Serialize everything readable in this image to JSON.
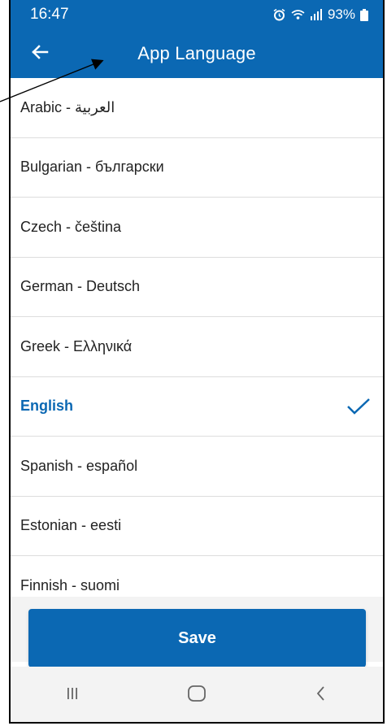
{
  "status_bar": {
    "time": "16:47",
    "battery": "93%",
    "alarm_icon": "alarm-clock-icon",
    "wifi_icon": "wifi-icon",
    "signal_icon": "signal-bars-icon",
    "battery_icon": "battery-icon"
  },
  "app_bar": {
    "title": "App Language",
    "back_icon": "arrow-left-icon"
  },
  "languages": [
    {
      "label": "Arabic - العربية"
    },
    {
      "label": "Bulgarian - български"
    },
    {
      "label": "Czech - čeština"
    },
    {
      "label": "German - Deutsch"
    },
    {
      "label": "Greek - Ελληνικά"
    },
    {
      "label": "English"
    },
    {
      "label": "Spanish - español"
    },
    {
      "label": "Estonian - eesti"
    },
    {
      "label": "Finnish - suomi"
    }
  ],
  "selected_language": "English",
  "save_button": {
    "label": "Save"
  },
  "nav_bar": {
    "recent_icon": "recent-apps-icon",
    "home_icon": "home-icon",
    "back_icon": "chevron-left-icon"
  },
  "colors": {
    "primary": "#0b68b3",
    "text": "#222222",
    "divider": "#dddddd",
    "footer_bg": "#f3f3f3"
  }
}
